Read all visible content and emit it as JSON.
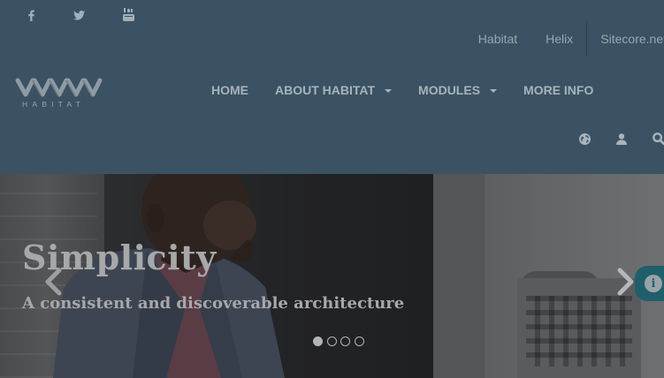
{
  "social": {
    "items": [
      {
        "icon": "facebook-icon",
        "label": "f"
      },
      {
        "icon": "twitter-icon"
      },
      {
        "icon": "youtube-icon",
        "label": "You Tube"
      }
    ]
  },
  "top_links": [
    "Habitat",
    "Helix",
    "Sitecore.net"
  ],
  "logo": {
    "wordmark": "HABITAT"
  },
  "nav": {
    "items": [
      {
        "label": "HOME",
        "has_dropdown": false
      },
      {
        "label": "ABOUT HABITAT",
        "has_dropdown": true
      },
      {
        "label": "MODULES",
        "has_dropdown": true
      },
      {
        "label": "MORE INFO",
        "has_dropdown": false
      }
    ]
  },
  "utility_icons": [
    "globe-icon",
    "user-icon",
    "search-icon"
  ],
  "carousel": {
    "title": "Simplicity",
    "subtitle": "A consistent and discoverable architecture",
    "slide_count": 4,
    "active_slide": 1
  },
  "info_tab": {
    "glyph": "i"
  },
  "colors": {
    "header_bg": "#3a5263",
    "nav_text": "#a7b3bb",
    "info_tab": "#1f5f6c"
  }
}
